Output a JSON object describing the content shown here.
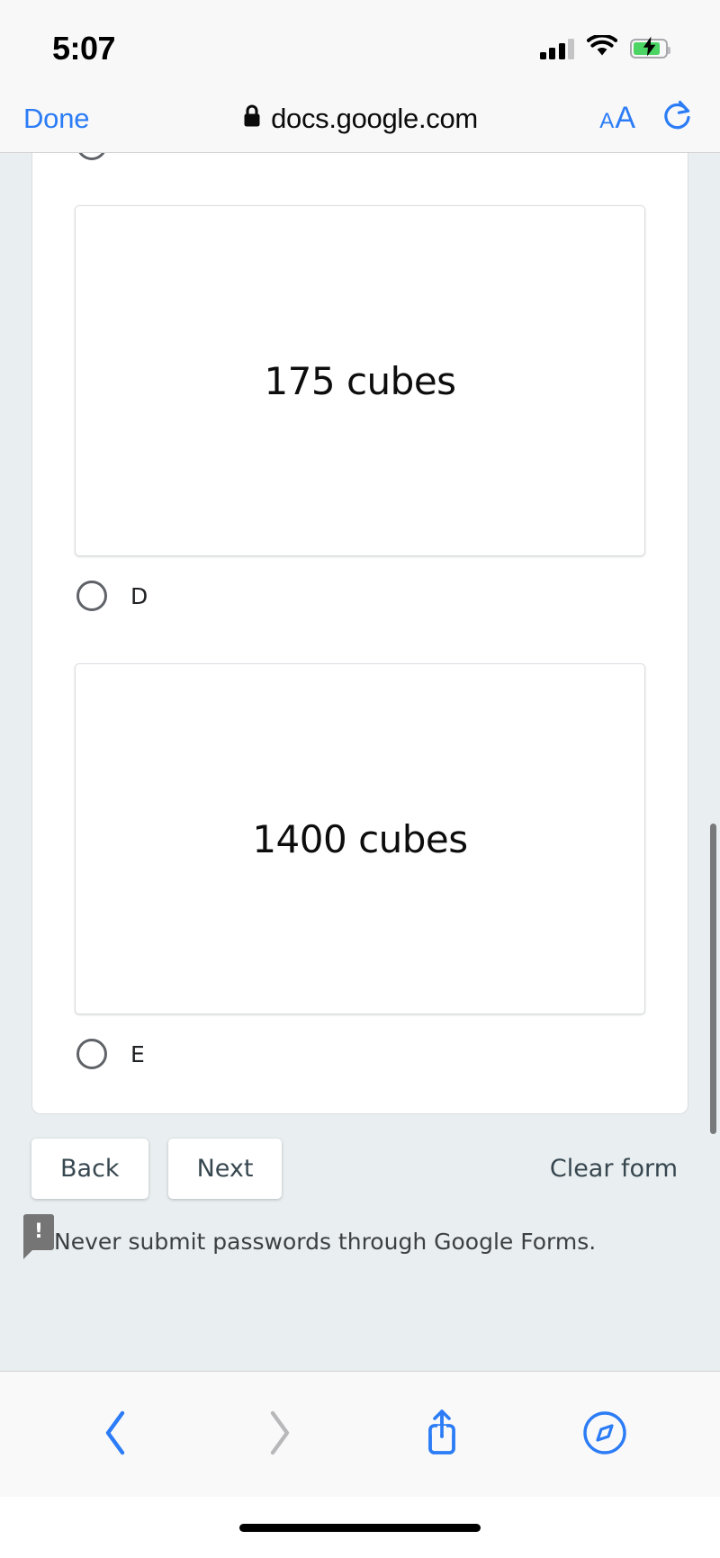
{
  "status_bar": {
    "time": "5:07",
    "cellular_icon": "cellular-signal-icon",
    "wifi_icon": "wifi-icon",
    "battery_icon": "battery-charging-icon",
    "battery_color": "#4cd464"
  },
  "browser": {
    "done_label": "Done",
    "lock_icon": "lock-icon",
    "url": "docs.google.com",
    "text_size_label_small": "A",
    "text_size_label_large": "A",
    "reload_icon": "reload-icon",
    "accent_color": "#2b7cf6"
  },
  "form": {
    "options": [
      {
        "id": "D",
        "image_text": "175 cubes",
        "selected": false
      },
      {
        "id": "E",
        "image_text": "1400 cubes",
        "selected": false
      }
    ],
    "back_label": "Back",
    "next_label": "Next",
    "clear_label": "Clear form",
    "notice_text": "Never submit passwords through Google Forms.",
    "notice_icon": "warning-tooltip-icon",
    "page_background": "#e9eef1"
  },
  "bottom_toolbar": {
    "back_icon": "chevron-left-icon",
    "forward_icon": "chevron-right-icon",
    "share_icon": "share-icon",
    "tabs_icon": "compass-bookmarks-icon",
    "active_color": "#2b7cf6",
    "disabled_color": "#b8b8bb"
  }
}
